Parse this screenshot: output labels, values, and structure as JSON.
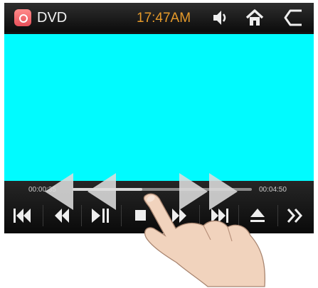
{
  "header": {
    "app_icon": "dvd-app-icon",
    "app_title": "DVD",
    "clock": "17:47AM",
    "icons": [
      "volume-icon",
      "home-icon",
      "back-icon"
    ]
  },
  "player": {
    "time_elapsed": "00:00:35",
    "time_total": "00:04:50",
    "progress": 0.39
  },
  "controls": [
    {
      "name": "previous-track-button",
      "icon": "skip-back-icon"
    },
    {
      "name": "rewind-button",
      "icon": "rewind-icon"
    },
    {
      "name": "play-pause-button",
      "icon": "play-pause-icon"
    },
    {
      "name": "stop-button",
      "icon": "stop-icon"
    },
    {
      "name": "fast-forward-button",
      "icon": "fast-forward-icon"
    },
    {
      "name": "next-track-button",
      "icon": "skip-forward-icon"
    },
    {
      "name": "eject-button",
      "icon": "eject-icon"
    },
    {
      "name": "more-button",
      "icon": "chevrons-right-icon"
    }
  ],
  "colors": {
    "screen": "#00fbff",
    "clock": "#e69a2a",
    "bar": "#121212"
  }
}
